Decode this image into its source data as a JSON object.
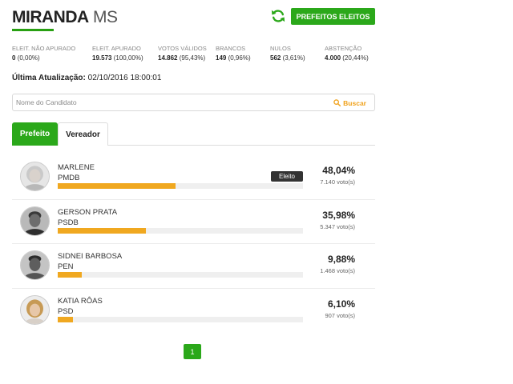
{
  "header": {
    "city": "MIRANDA",
    "state": "MS",
    "elected_button_label": "PREFEITOS ELEITOS"
  },
  "stats": [
    {
      "label": "ELEIT. NÃO APURADO",
      "value": "0",
      "pct": "(0,00%)"
    },
    {
      "label": "ELEIT. APURADO",
      "value": "19.573",
      "pct": "(100,00%)"
    },
    {
      "label": "VOTOS VÁLIDOS",
      "value": "14.862",
      "pct": "(95,43%)"
    },
    {
      "label": "BRANCOS",
      "value": "149",
      "pct": "(0,96%)"
    },
    {
      "label": "NULOS",
      "value": "562",
      "pct": "(3,61%)"
    },
    {
      "label": "ABSTENÇÃO",
      "value": "4.000",
      "pct": "(20,44%)"
    }
  ],
  "update": {
    "label": "Última Atualização:",
    "value": "02/10/2016 18:00:01"
  },
  "search": {
    "placeholder": "Nome do Candidato",
    "button_label": "Buscar"
  },
  "tabs": [
    {
      "label": "Prefeito",
      "active": true
    },
    {
      "label": "Vereador",
      "active": false
    }
  ],
  "candidates": [
    {
      "name": "MARLENE",
      "party": "PMDB",
      "percent": "48,04%",
      "votes": "7.140 voto(s)",
      "share": 48.04,
      "elected": true,
      "elected_label": "Eleito"
    },
    {
      "name": "GERSON PRATA",
      "party": "PSDB",
      "percent": "35,98%",
      "votes": "5.347 voto(s)",
      "share": 35.98,
      "elected": false
    },
    {
      "name": "SIDNEI BARBOSA",
      "party": "PEN",
      "percent": "9,88%",
      "votes": "1.468 voto(s)",
      "share": 9.88,
      "elected": false
    },
    {
      "name": "KATIA RÔAS",
      "party": "PSD",
      "percent": "6,10%",
      "votes": "907 voto(s)",
      "share": 6.1,
      "elected": false
    }
  ],
  "pagination": {
    "current": "1"
  },
  "colors": {
    "green": "#2ba81a",
    "bar": "#f0a820",
    "search_accent": "#f0a11a"
  }
}
